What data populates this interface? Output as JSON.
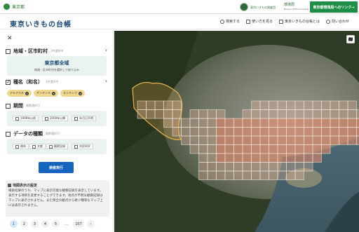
{
  "header": {
    "org": "東京都",
    "partner": "東京いきもの調査団",
    "bureau": "環境局",
    "bureau_en": "Bureau of Environment",
    "link_button": "東京都環境局へのリンク→"
  },
  "app": {
    "title": "東京いきもの台帳",
    "nav": [
      {
        "label": "検索する",
        "icon": "search-icon"
      },
      {
        "label": "使い方を見る",
        "icon": "book-icon"
      },
      {
        "label": "東京いきもの台帳とは",
        "icon": "document-icon"
      },
      {
        "label": "問い合わせ",
        "icon": "question-icon"
      }
    ]
  },
  "filters": {
    "area": {
      "label": "地域・区市町村",
      "note": "1件選択中",
      "selected": "東京都全域",
      "hint": "地域・区市町村を選択して絞り込み"
    },
    "species": {
      "label": "種名（和名）",
      "note": "3件選択中",
      "tags": [
        "アキアカネ",
        "ギンヤンマ",
        "オニヤンマ"
      ]
    },
    "period": {
      "label": "期間",
      "note": "複数選択可",
      "options": [
        "1999年以前",
        "2000年以降",
        "年月日不明"
      ]
    },
    "data_type": {
      "label": "データの種類",
      "note": "複数選択可",
      "options": [
        "標本",
        "文献",
        "観察記録",
        "市民科学"
      ]
    },
    "execute": "検索実行"
  },
  "info": {
    "title": "地図表示の設定",
    "body": "検索結果のうち、マップに表示可能な観察記録を表示しています。表示する項目を変更することができます。地点が不明な観察記録はマップに表示されません。また保全の観点から希少種等もマップ上には表示されません。"
  },
  "pagination": {
    "pages": [
      "1",
      "2",
      "3",
      "4",
      "5",
      "…",
      "107"
    ],
    "current": "1",
    "next": "›"
  },
  "map": {
    "layers_icon": "map-layers-icon"
  }
}
